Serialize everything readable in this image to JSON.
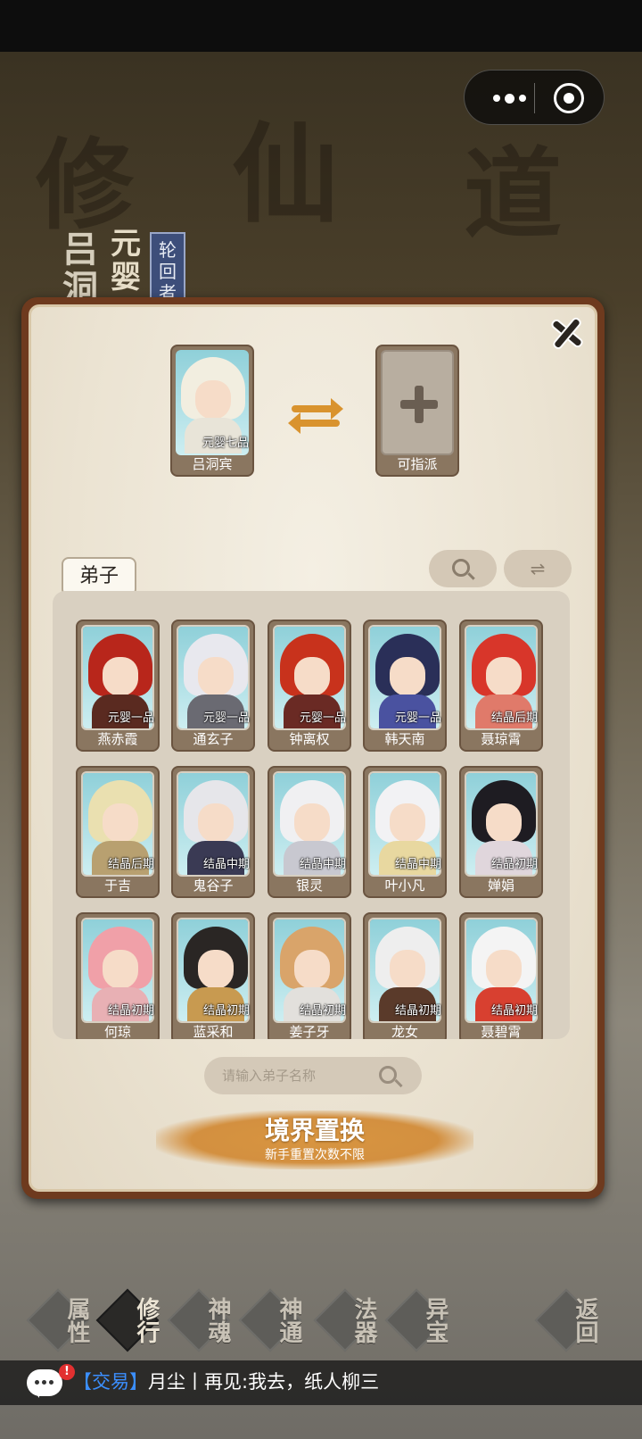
{
  "background": {
    "hero_name": "吕洞",
    "hero_realm": "元婴",
    "hero_tag": "轮回者"
  },
  "swap": {
    "current": {
      "name": "吕洞宾",
      "realm": "元婴七品"
    },
    "target": {
      "label": "可指派"
    }
  },
  "tabs": [
    {
      "label": "弟子"
    }
  ],
  "disciples": [
    {
      "name": "燕赤霞",
      "realm": "元婴一品",
      "hair": "#b8261b",
      "body": "#5a2a20"
    },
    {
      "name": "通玄子",
      "realm": "元婴一品",
      "hair": "#e8e8ee",
      "body": "#6a6a72"
    },
    {
      "name": "钟离权",
      "realm": "元婴一品",
      "hair": "#c8321c",
      "body": "#6a2a24"
    },
    {
      "name": "韩天南",
      "realm": "元婴一品",
      "hair": "#2a2f58",
      "body": "#4a52a0"
    },
    {
      "name": "聂琼霄",
      "realm": "结晶后期",
      "hair": "#d8362a",
      "body": "#e07a6a"
    },
    {
      "name": "于吉",
      "realm": "结晶后期",
      "hair": "#eae0b0",
      "body": "#b8a070"
    },
    {
      "name": "鬼谷子",
      "realm": "结晶中期",
      "hair": "#e6e6ea",
      "body": "#3a3a54"
    },
    {
      "name": "银灵",
      "realm": "结晶中期",
      "hair": "#f0f0f2",
      "body": "#c8c8d0"
    },
    {
      "name": "叶小凡",
      "realm": "结晶中期",
      "hair": "#f2f2f4",
      "body": "#e8d8a0"
    },
    {
      "name": "婵娟",
      "realm": "结晶初期",
      "hair": "#1e1c22",
      "body": "#e0d6dc"
    },
    {
      "name": "何琼",
      "realm": "结晶初期",
      "hair": "#f0a0a8",
      "body": "#e8b0b4"
    },
    {
      "name": "蓝采和",
      "realm": "结晶初期",
      "hair": "#2a2624",
      "body": "#c89a50"
    },
    {
      "name": "姜子牙",
      "realm": "结晶初期",
      "hair": "#d9a46a",
      "body": "#e2e0dc"
    },
    {
      "name": "龙女",
      "realm": "结晶初期",
      "hair": "#eeeeee",
      "body": "#5a3a2a"
    },
    {
      "name": "聂碧霄",
      "realm": "结晶初期",
      "hair": "#f4f4f4",
      "body": "#d84030"
    }
  ],
  "search": {
    "placeholder": "请输入弟子名称"
  },
  "action": {
    "title": "境界置换",
    "subtitle": "新手重置次数不限"
  },
  "nav": [
    {
      "label": "属性",
      "icon": "attributes-icon"
    },
    {
      "label": "修行",
      "icon": "cultivate-icon",
      "active": true
    },
    {
      "label": "神魂",
      "icon": "soul-icon"
    },
    {
      "label": "神通",
      "icon": "power-icon"
    },
    {
      "label": "法器",
      "icon": "artifact-icon"
    },
    {
      "label": "异宝",
      "icon": "treasure-icon"
    },
    {
      "label": "返回",
      "icon": "back-icon"
    }
  ],
  "chat": {
    "badge": "!",
    "channel": "【交易】",
    "message": "月尘丨再见:我去，纸人柳三"
  },
  "colors": {
    "accent": "#d9932e",
    "frame": "#6e3a1e",
    "link": "#3b8fff"
  }
}
